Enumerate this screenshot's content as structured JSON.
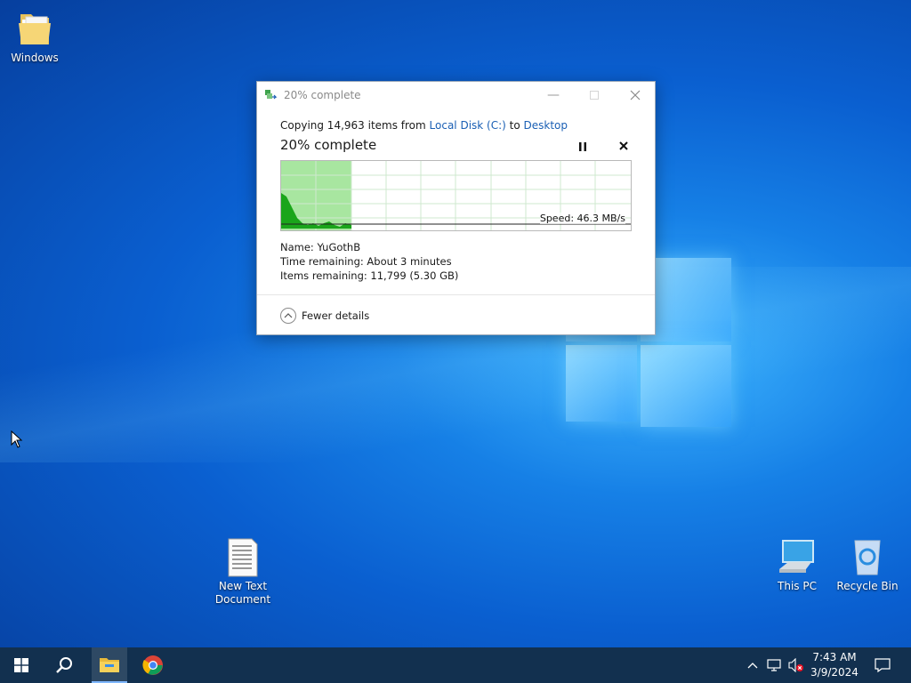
{
  "desktop": {
    "icons": [
      {
        "label": "Windows"
      },
      {
        "label": "New Text\nDocument"
      },
      {
        "label": "This PC"
      },
      {
        "label": "Recycle Bin"
      }
    ]
  },
  "dialog": {
    "title": "20% complete",
    "copy_prefix": "Copying 14,963 items from ",
    "source": "Local Disk (C:)",
    "copy_mid": " to ",
    "destination": "Desktop",
    "progress_text": "20% complete",
    "progress_fraction": 0.2,
    "speed": "Speed: 46.3 MB/s",
    "name_row": "Name:  YuGothB",
    "time_row": "Time remaining:  About 3 minutes",
    "items_row": "Items remaining:  11,799 (5.30 GB)",
    "fewer_details": "Fewer details",
    "icons": {
      "minimize": "minimize-icon",
      "maximize": "maximize-icon",
      "close": "close-icon",
      "pause": "pause-icon",
      "cancel": "cancel-icon"
    }
  },
  "taskbar": {
    "time": "7:43 AM",
    "date": "3/9/2024",
    "items": [
      "start-icon",
      "search-icon",
      "file-explorer-icon",
      "chrome-icon"
    ],
    "tray": [
      "chevron-up-icon",
      "network-icon",
      "volume-muted-icon",
      "notification-icon"
    ]
  },
  "colors": {
    "accent": "#1a5fb4",
    "graph_fill": "#a8e6a0",
    "graph_line": "#1aa51a",
    "taskbar": "#12304f"
  }
}
